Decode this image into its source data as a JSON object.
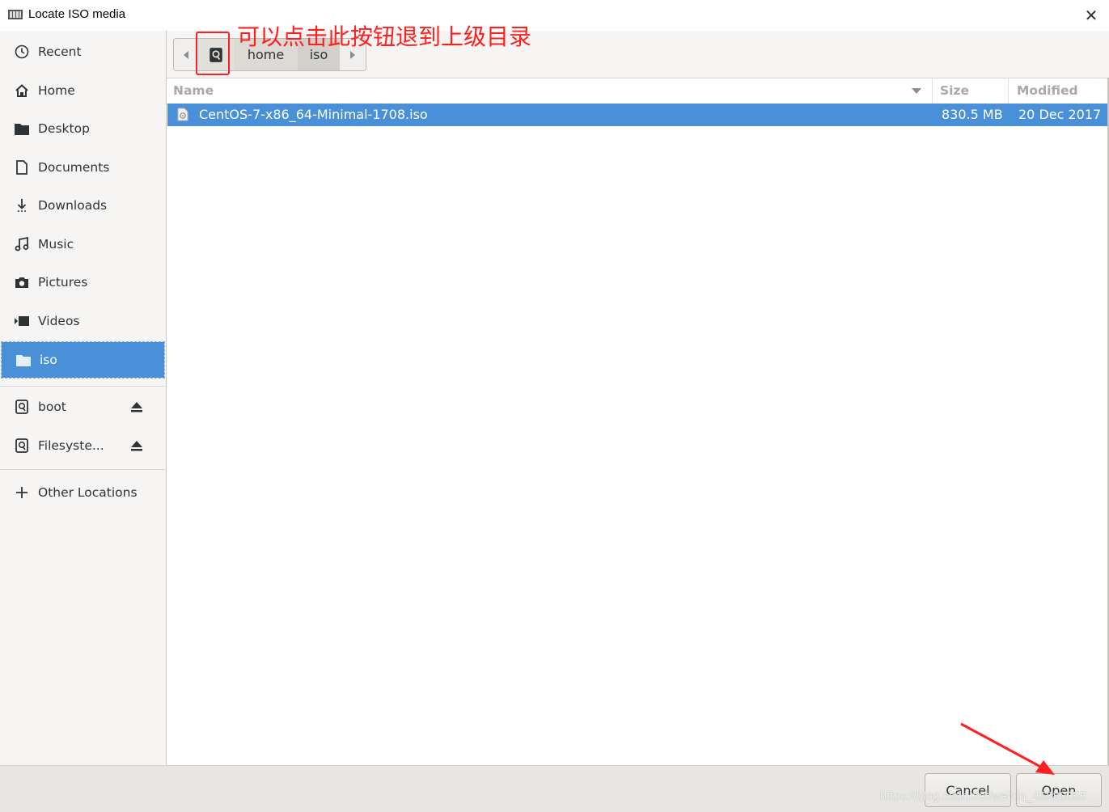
{
  "window": {
    "title": "Locate ISO media",
    "close_glyph": "✕"
  },
  "sidebar": {
    "items": [
      {
        "label": "Recent",
        "icon": "clock-icon"
      },
      {
        "label": "Home",
        "icon": "home-icon"
      },
      {
        "label": "Desktop",
        "icon": "folder-icon"
      },
      {
        "label": "Documents",
        "icon": "document-icon"
      },
      {
        "label": "Downloads",
        "icon": "download-icon"
      },
      {
        "label": "Music",
        "icon": "music-icon"
      },
      {
        "label": "Pictures",
        "icon": "camera-icon"
      },
      {
        "label": "Videos",
        "icon": "video-icon"
      },
      {
        "label": "iso",
        "icon": "folder-icon",
        "selected": true
      }
    ],
    "devices": [
      {
        "label": "boot",
        "icon": "drive-icon"
      },
      {
        "label": "Filesyste...",
        "icon": "drive-icon"
      }
    ],
    "other": {
      "label": "Other Locations",
      "icon": "plus-icon"
    }
  },
  "pathbar": {
    "segments": [
      "home",
      "iso"
    ]
  },
  "annotation": {
    "text": "可以点击此按钮退到上级目录",
    "color": "#ff1f1f"
  },
  "file_list": {
    "columns": {
      "name": "Name",
      "size": "Size",
      "modified": "Modified"
    },
    "rows": [
      {
        "name": "CentOS-7-x86_64-Minimal-1708.iso",
        "size": "830.5 MB",
        "modified": "20 Dec 2017",
        "selected": true
      }
    ]
  },
  "actions": {
    "cancel": "Cancel",
    "open": "Open"
  },
  "watermark": "https://blog.csdn.net/weixin_45880055",
  "colors": {
    "selection": "#4a90d9",
    "sidebar_bg": "#f6f5f4",
    "annotation": "#ff1f1f"
  }
}
